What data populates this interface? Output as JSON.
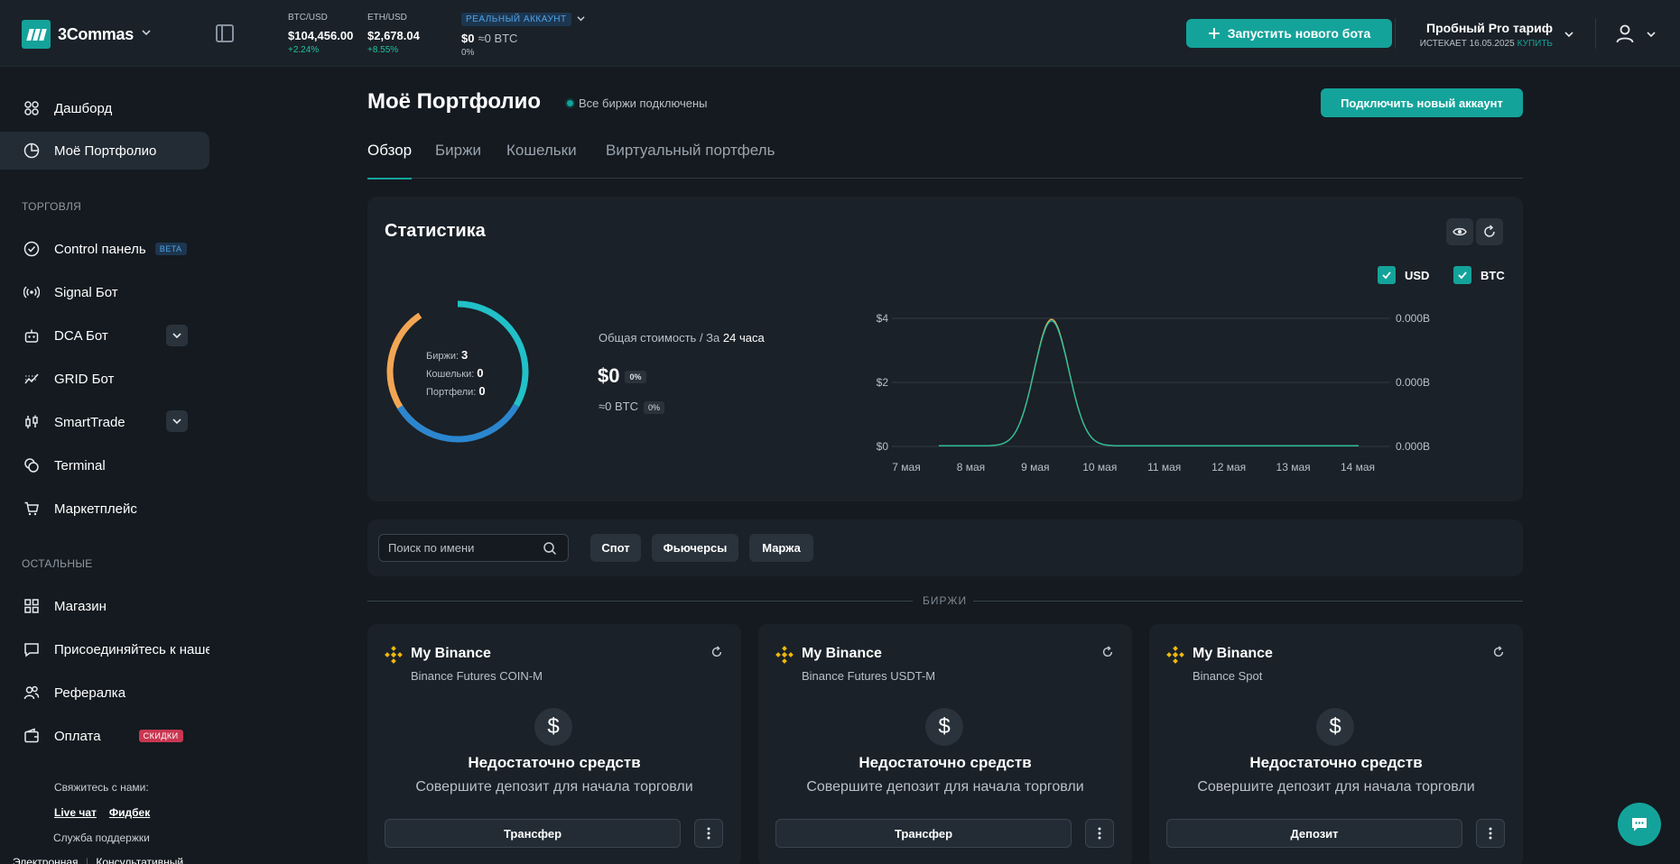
{
  "app": {
    "name": "3Commas"
  },
  "topbar": {
    "tickers": [
      {
        "pair": "BTC/USD",
        "price": "$104,456.00",
        "change": "+2.24%"
      },
      {
        "pair": "ETH/USD",
        "price": "$2,678.04",
        "change": "+8.55%"
      }
    ],
    "account": {
      "badge": "РЕАЛЬНЫЙ АККАУНТ",
      "balance_usd": "$0",
      "balance_btc": "≈0 BTC",
      "change": "0%"
    },
    "new_bot_label": "Запустить нового бота",
    "plan": {
      "name": "Пробный Pro тариф",
      "expires": "ИСТЕКАЕТ 16.05.2025",
      "buy": "КУПИТЬ"
    }
  },
  "sidebar": {
    "top_items": [
      {
        "label": "Дашборд",
        "icon": "dashboard-icon"
      },
      {
        "label": "Моё Портфолио",
        "icon": "pie-chart-icon",
        "active": true
      }
    ],
    "section_trading": "ТОРГОВЛЯ",
    "trading_items": [
      {
        "label": "Control панель",
        "icon": "check-circle-icon",
        "badge": "BETA"
      },
      {
        "label": "Signal Бот",
        "icon": "signal-icon"
      },
      {
        "label": "DCA Бот",
        "icon": "robot-icon",
        "expandable": true
      },
      {
        "label": "GRID Бот",
        "icon": "grid-chart-icon"
      },
      {
        "label": "SmartTrade",
        "icon": "candles-icon",
        "expandable": true
      },
      {
        "label": "Terminal",
        "icon": "coins-icon"
      },
      {
        "label": "Маркетплейс",
        "icon": "cart-icon"
      }
    ],
    "section_other": "ОСТАЛЬНЫЕ",
    "other_items": [
      {
        "label": "Магазин",
        "icon": "apps-icon"
      },
      {
        "label": "Присоединяйтесь к наше",
        "icon": "chat-icon"
      },
      {
        "label": "Рефералка",
        "icon": "users-icon"
      },
      {
        "label": "Оплата",
        "icon": "wallet-icon",
        "badge": "СКИДКИ"
      }
    ],
    "contact_title": "Свяжитесь с нами:",
    "contact_live": "Live чат",
    "contact_feedback": "Фидбек",
    "support": "Служба поддержки",
    "bottom_links": [
      "Электронная",
      "Консультативный"
    ]
  },
  "page": {
    "title": "Моё Портфолио",
    "status": "Все биржи подключены",
    "connect_label": "Подключить новый аккаунт",
    "tabs": [
      "Обзор",
      "Биржи",
      "Кошельки",
      "Виртуальный портфель"
    ]
  },
  "stats": {
    "title": "Статистика",
    "legend_usd": "USD",
    "legend_btc": "BTC",
    "donut": {
      "exchanges_label": "Биржи:",
      "exchanges": "3",
      "wallets_label": "Кошельки:",
      "wallets": "0",
      "portfolios_label": "Портфели:",
      "portfolios": "0"
    },
    "total_label": "Общая стоимость / За",
    "total_period": "24 часа",
    "total_usd": "$0",
    "total_usd_change": "0%",
    "total_btc": "≈0 BTC",
    "total_btc_change": "0%"
  },
  "chart_data": {
    "type": "line",
    "x": [
      "7 мая",
      "8 мая",
      "9 мая",
      "10 мая",
      "11 мая",
      "12 мая",
      "13 мая",
      "14 мая"
    ],
    "y_left_ticks": [
      "$0",
      "$2",
      "$4"
    ],
    "y_right_ticks": [
      "0.000B",
      "0.000B",
      "0.000B"
    ],
    "ylim": [
      0,
      4
    ],
    "series": [
      {
        "name": "USD",
        "color": "#22c1a0",
        "values": [
          0.0,
          0.0,
          3.9,
          0.0,
          0.0,
          0.0,
          0.0,
          0.0
        ]
      },
      {
        "name": "BTC",
        "color": "#e8b05a",
        "values": [
          0.0,
          0.0,
          3.95,
          0.0,
          0.0,
          0.0,
          0.0,
          0.0
        ]
      }
    ],
    "grid": true
  },
  "filters": {
    "search_placeholder": "Поиск по имени",
    "chips": [
      "Спот",
      "Фьючерсы",
      "Маржа"
    ]
  },
  "exchanges_section": "БИРЖИ",
  "exchanges": [
    {
      "name": "My Binance",
      "type": "Binance Futures COIN-M",
      "message": "Недостаточно средств",
      "hint": "Совершите депозит для начала торговли",
      "action": "Трансфер"
    },
    {
      "name": "My Binance",
      "type": "Binance Futures USDT-M",
      "message": "Недостаточно средств",
      "hint": "Совершите депозит для начала торговли",
      "action": "Трансфер"
    },
    {
      "name": "My Binance",
      "type": "Binance Spot",
      "message": "Недостаточно средств",
      "hint": "Совершите депозит для начала торговли",
      "action": "Депозит"
    }
  ],
  "colors": {
    "accent": "#14a39a",
    "background": "#141a20",
    "card": "#1a2128",
    "donut_orange": "#f2a654",
    "donut_teal": "#22c0c8",
    "donut_blue": "#2b86cf",
    "binance": "#f0b90b"
  }
}
